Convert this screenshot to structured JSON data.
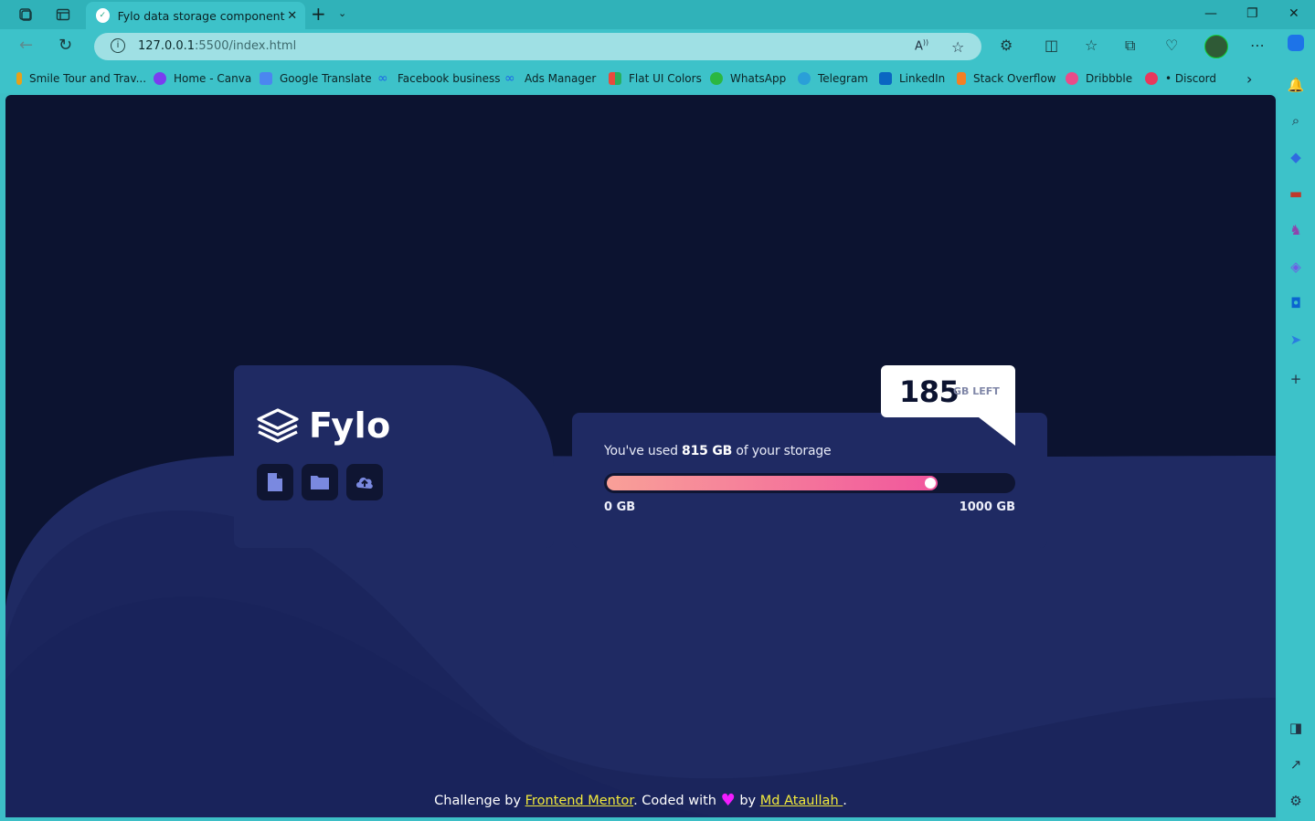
{
  "browser": {
    "tab_title": "Fylo data storage component",
    "url_host": "127.0.0.1",
    "url_rest": ":5500/index.html",
    "bookmarks": [
      {
        "label": "Smile Tour and Trav...",
        "color": "#e6a11a"
      },
      {
        "label": "Home - Canva",
        "color": "#7a3df0"
      },
      {
        "label": "Google Translate",
        "color": "#4b86f0"
      },
      {
        "label": "Facebook business",
        "color": "#1c67e6"
      },
      {
        "label": "Ads Manager",
        "color": "#1c67e6"
      },
      {
        "label": "Flat UI Colors",
        "color": "#e84a3c"
      },
      {
        "label": "WhatsApp",
        "color": "#2bb741"
      },
      {
        "label": "Telegram",
        "color": "#2a9fd8"
      },
      {
        "label": "LinkedIn",
        "color": "#0a66c2"
      },
      {
        "label": "Stack Overflow",
        "color": "#f48024"
      },
      {
        "label": "Dribbble",
        "color": "#ea4c89"
      },
      {
        "label": "• Discord",
        "color": "#e8385c"
      }
    ]
  },
  "app": {
    "logo_text": "Fylo",
    "usage": {
      "prefix": "You've used ",
      "amount": "815 GB",
      "suffix": " of your storage"
    },
    "used_gb": 815,
    "total_gb": 1000,
    "min_label": "0 GB",
    "max_label": "1000 GB",
    "remaining_value": "185",
    "remaining_unit": "GB LEFT",
    "colors": {
      "bg": "#0c1330",
      "card": "#1f2a63",
      "gradient_start": "#f9a098",
      "gradient_end": "#f1569d"
    }
  },
  "footer": {
    "prefix": "Challenge by ",
    "link1": "Frontend Mentor",
    "mid": ". Coded with ",
    "heart": "♥",
    "by": " by ",
    "link2": "Md Ataullah ",
    "end": "."
  }
}
